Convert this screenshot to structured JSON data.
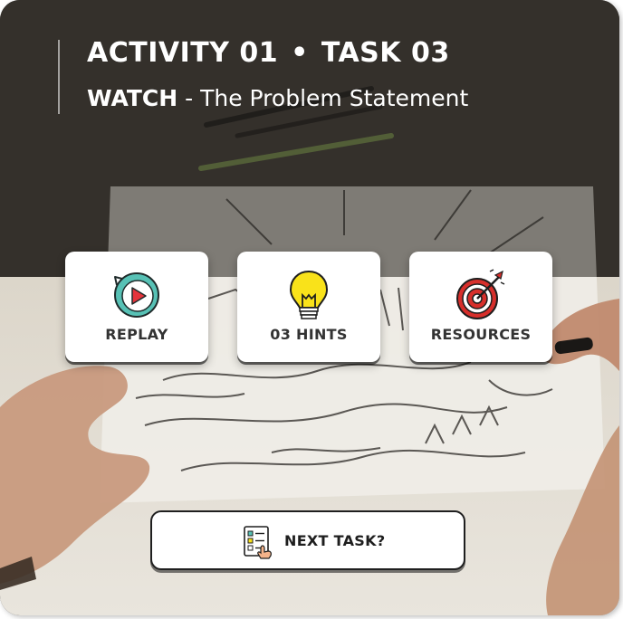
{
  "header": {
    "activity": "ACTIVITY 01",
    "separator": "•",
    "task": "TASK 03",
    "mode": "WATCH",
    "subtitle": " - The Problem Statement"
  },
  "tiles": [
    {
      "label": "REPLAY",
      "icon": "replay-icon"
    },
    {
      "label": "03 HINTS",
      "icon": "lightbulb-icon"
    },
    {
      "label": "RESOURCES",
      "icon": "target-icon"
    }
  ],
  "next_button": {
    "label": "NEXT TASK?",
    "icon": "checklist-icon"
  },
  "colors": {
    "header_overlay": "#3b3731",
    "paper": "#e6e2d8",
    "replay_teal": "#57c1b5",
    "play_red": "#e5343c",
    "bulb_yellow": "#f9e21a",
    "target_red": "#d72f2b"
  }
}
